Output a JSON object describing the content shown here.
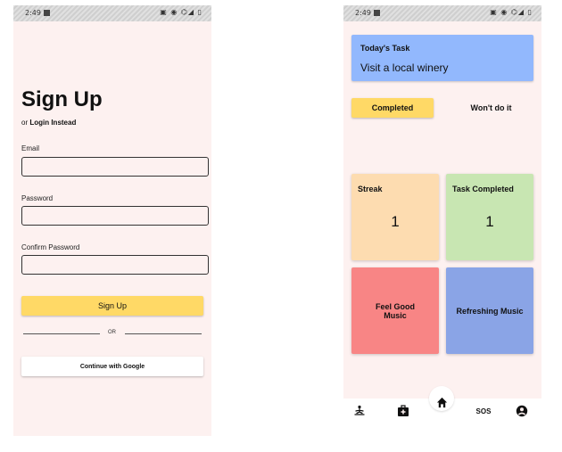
{
  "status_bar": {
    "time": "2:49",
    "right_icons": "▣ ◉ ⌬◢ ▯"
  },
  "signup": {
    "title": "Sign Up",
    "login_prefix": "or ",
    "login_link": "Login Instead",
    "email_label": "Email",
    "email_value": "",
    "password_label": "Password",
    "password_value": "",
    "confirm_label": "Confirm Password",
    "confirm_value": "",
    "signup_button": "Sign Up",
    "or_text": "OR",
    "google_button": "Continue with Google"
  },
  "home": {
    "task_label": "Today's Task",
    "task_text": "Visit a local winery",
    "completed_button": "Completed",
    "wont_button": "Won't do it",
    "streak_label": "Streak",
    "streak_value": "1",
    "task_completed_label": "Task Completed",
    "task_completed_value": "1",
    "feel_good_music": "Feel Good Music",
    "refreshing_music": "Refreshing Music",
    "nav": {
      "sos_label": "SOS",
      "icons": [
        "meditation-icon",
        "first-aid-kit-icon",
        "home-icon",
        "sos-icon",
        "account-icon"
      ]
    }
  },
  "colors": {
    "background": "#fdf1f0",
    "accent_yellow": "#ffd966",
    "task_blue": "#92b8fd",
    "streak_orange": "#fddcb0",
    "completed_green": "#c8e6b2",
    "music_red": "#f88585",
    "music_blue": "#8aa4e6"
  }
}
